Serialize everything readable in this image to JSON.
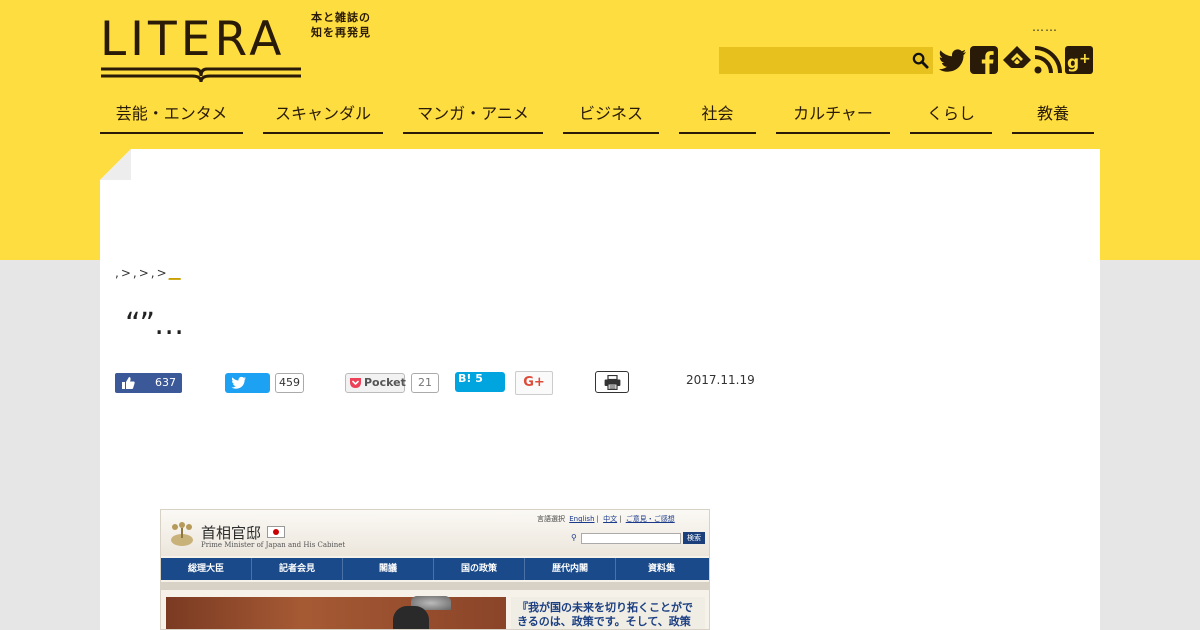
{
  "site": {
    "logo_text": "LITERA",
    "tagline": "本と雑誌の\n知を再発見",
    "header_dots": "……"
  },
  "nav": {
    "items": [
      {
        "label": "芸能・エンタメ"
      },
      {
        "label": "スキャンダル"
      },
      {
        "label": "マンガ・アニメ"
      },
      {
        "label": "ビジネス"
      },
      {
        "label": "社会"
      },
      {
        "label": "カルチャー"
      },
      {
        "label": "くらし"
      },
      {
        "label": "教養"
      }
    ]
  },
  "social_icons": [
    "twitter-icon",
    "facebook-icon",
    "feedly-icon",
    "rss-icon",
    "google-plus-icon"
  ],
  "article": {
    "breadcrumb": [
      ",",
      ">",
      ",",
      ">",
      ",",
      ">"
    ],
    "breadcrumb_current": "__",
    "title": "“”…",
    "date": "2017.11.19"
  },
  "share": {
    "like_count": "637",
    "tweet_count": "459",
    "pocket_label": "Pocket",
    "pocket_count": "21",
    "hatena_label": "B! 5",
    "gplus_label": "G+"
  },
  "embed": {
    "title": "首相官邸",
    "subtitle": "Prime Minister of Japan and His Cabinet",
    "links_label": "言語選択",
    "link_english": "English",
    "link_chinese": "中文",
    "link_opinion": "ご意見・ご感想",
    "search_btn": "検索",
    "nav": [
      "総理大臣",
      "記者会見",
      "閣議",
      "国の政策",
      "歴代内閣",
      "資料集"
    ],
    "quote": "『我が国の未来を切り拓くことができるのは、政策です。そして、政策"
  },
  "colors": {
    "brand_yellow": "#fddd3f",
    "search_yellow": "#e7c21f",
    "dark_brown": "#2a1a08",
    "facebook_blue": "#3b5998",
    "twitter_blue": "#1da1f2",
    "hatena_blue": "#00a4de"
  }
}
